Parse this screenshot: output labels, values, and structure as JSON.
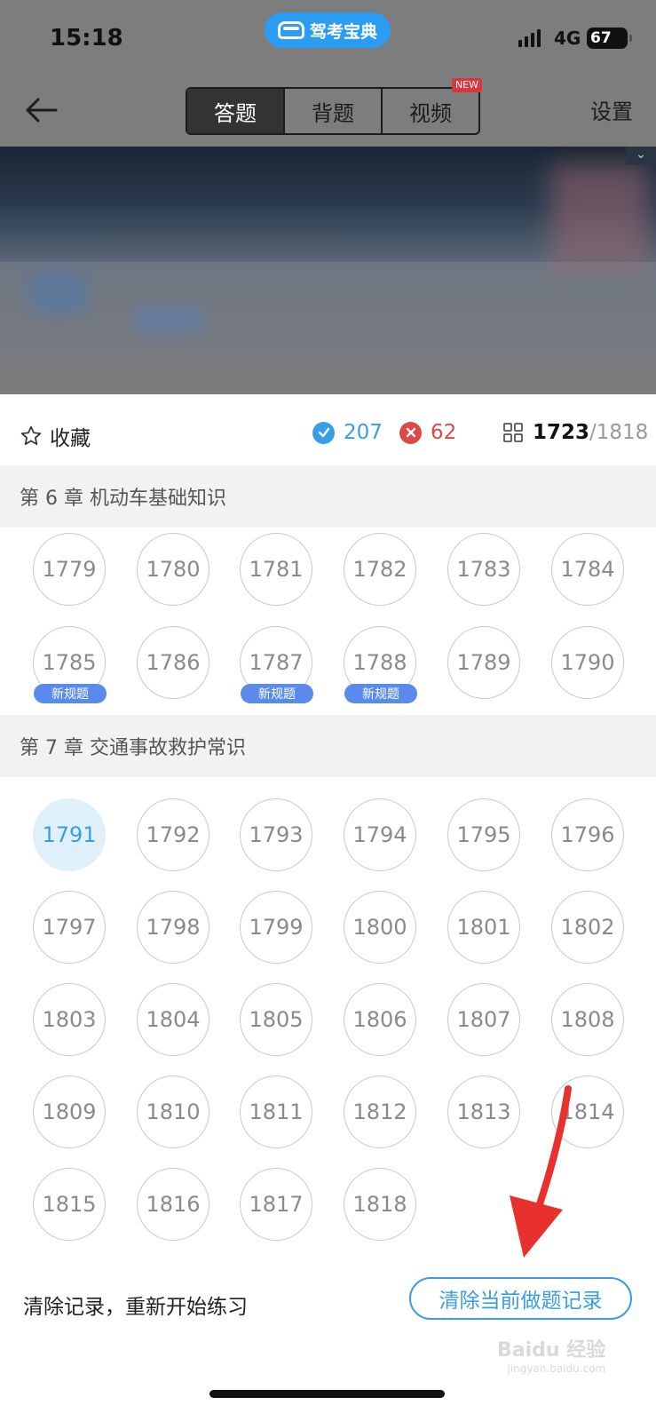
{
  "status_bar": {
    "time": "15:18",
    "app_badge": "驾考宝典",
    "network": "4G",
    "battery": "67"
  },
  "nav": {
    "tabs": [
      {
        "label": "答题",
        "active": true
      },
      {
        "label": "背题",
        "active": false
      },
      {
        "label": "视频",
        "active": false
      }
    ],
    "new_badge": "NEW",
    "settings": "设置"
  },
  "panel": {
    "favorite_label": "收藏",
    "correct_count": "207",
    "wrong_count": "62",
    "current": "1723",
    "total": "/1818"
  },
  "chapters": [
    {
      "title": "第 6 章  机动车基础知识",
      "items": [
        {
          "num": "1779"
        },
        {
          "num": "1780"
        },
        {
          "num": "1781"
        },
        {
          "num": "1782"
        },
        {
          "num": "1783"
        },
        {
          "num": "1784"
        },
        {
          "num": "1785",
          "tag": "新规题"
        },
        {
          "num": "1786"
        },
        {
          "num": "1787",
          "tag": "新规题"
        },
        {
          "num": "1788",
          "tag": "新规题"
        },
        {
          "num": "1789"
        },
        {
          "num": "1790"
        }
      ]
    },
    {
      "title": "第 7 章  交通事故救护常识",
      "items": [
        {
          "num": "1791",
          "current": true
        },
        {
          "num": "1792"
        },
        {
          "num": "1793"
        },
        {
          "num": "1794"
        },
        {
          "num": "1795"
        },
        {
          "num": "1796"
        },
        {
          "num": "1797"
        },
        {
          "num": "1798"
        },
        {
          "num": "1799"
        },
        {
          "num": "1800"
        },
        {
          "num": "1801"
        },
        {
          "num": "1802"
        },
        {
          "num": "1803"
        },
        {
          "num": "1804"
        },
        {
          "num": "1805"
        },
        {
          "num": "1806"
        },
        {
          "num": "1807"
        },
        {
          "num": "1808"
        },
        {
          "num": "1809"
        },
        {
          "num": "1810"
        },
        {
          "num": "1811"
        },
        {
          "num": "1812"
        },
        {
          "num": "1813"
        },
        {
          "num": "1814"
        },
        {
          "num": "1815"
        },
        {
          "num": "1816"
        },
        {
          "num": "1817"
        },
        {
          "num": "1818"
        }
      ]
    }
  ],
  "footer": {
    "hint": "清除记录，重新开始练习",
    "clear_button": "清除当前做题记录"
  },
  "watermark": {
    "brand": "Baidu 经验",
    "url": "jingyan.baidu.com"
  },
  "colors": {
    "accent": "#3a9ee6",
    "wrong": "#e04848",
    "tag": "#5a8bec",
    "annotation_arrow": "#e8312c"
  }
}
